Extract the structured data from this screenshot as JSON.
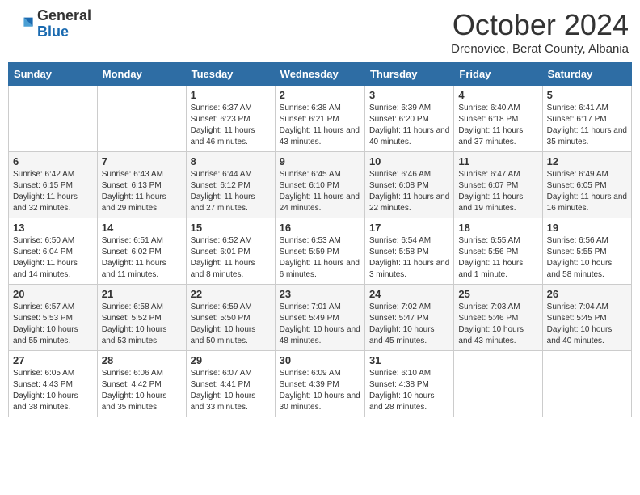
{
  "logo": {
    "general": "General",
    "blue": "Blue"
  },
  "title": "October 2024",
  "location": "Drenovice, Berat County, Albania",
  "days_of_week": [
    "Sunday",
    "Monday",
    "Tuesday",
    "Wednesday",
    "Thursday",
    "Friday",
    "Saturday"
  ],
  "weeks": [
    [
      {
        "day": "",
        "info": ""
      },
      {
        "day": "",
        "info": ""
      },
      {
        "day": "1",
        "info": "Sunrise: 6:37 AM\nSunset: 6:23 PM\nDaylight: 11 hours and 46 minutes."
      },
      {
        "day": "2",
        "info": "Sunrise: 6:38 AM\nSunset: 6:21 PM\nDaylight: 11 hours and 43 minutes."
      },
      {
        "day": "3",
        "info": "Sunrise: 6:39 AM\nSunset: 6:20 PM\nDaylight: 11 hours and 40 minutes."
      },
      {
        "day": "4",
        "info": "Sunrise: 6:40 AM\nSunset: 6:18 PM\nDaylight: 11 hours and 37 minutes."
      },
      {
        "day": "5",
        "info": "Sunrise: 6:41 AM\nSunset: 6:17 PM\nDaylight: 11 hours and 35 minutes."
      }
    ],
    [
      {
        "day": "6",
        "info": "Sunrise: 6:42 AM\nSunset: 6:15 PM\nDaylight: 11 hours and 32 minutes."
      },
      {
        "day": "7",
        "info": "Sunrise: 6:43 AM\nSunset: 6:13 PM\nDaylight: 11 hours and 29 minutes."
      },
      {
        "day": "8",
        "info": "Sunrise: 6:44 AM\nSunset: 6:12 PM\nDaylight: 11 hours and 27 minutes."
      },
      {
        "day": "9",
        "info": "Sunrise: 6:45 AM\nSunset: 6:10 PM\nDaylight: 11 hours and 24 minutes."
      },
      {
        "day": "10",
        "info": "Sunrise: 6:46 AM\nSunset: 6:08 PM\nDaylight: 11 hours and 22 minutes."
      },
      {
        "day": "11",
        "info": "Sunrise: 6:47 AM\nSunset: 6:07 PM\nDaylight: 11 hours and 19 minutes."
      },
      {
        "day": "12",
        "info": "Sunrise: 6:49 AM\nSunset: 6:05 PM\nDaylight: 11 hours and 16 minutes."
      }
    ],
    [
      {
        "day": "13",
        "info": "Sunrise: 6:50 AM\nSunset: 6:04 PM\nDaylight: 11 hours and 14 minutes."
      },
      {
        "day": "14",
        "info": "Sunrise: 6:51 AM\nSunset: 6:02 PM\nDaylight: 11 hours and 11 minutes."
      },
      {
        "day": "15",
        "info": "Sunrise: 6:52 AM\nSunset: 6:01 PM\nDaylight: 11 hours and 8 minutes."
      },
      {
        "day": "16",
        "info": "Sunrise: 6:53 AM\nSunset: 5:59 PM\nDaylight: 11 hours and 6 minutes."
      },
      {
        "day": "17",
        "info": "Sunrise: 6:54 AM\nSunset: 5:58 PM\nDaylight: 11 hours and 3 minutes."
      },
      {
        "day": "18",
        "info": "Sunrise: 6:55 AM\nSunset: 5:56 PM\nDaylight: 11 hours and 1 minute."
      },
      {
        "day": "19",
        "info": "Sunrise: 6:56 AM\nSunset: 5:55 PM\nDaylight: 10 hours and 58 minutes."
      }
    ],
    [
      {
        "day": "20",
        "info": "Sunrise: 6:57 AM\nSunset: 5:53 PM\nDaylight: 10 hours and 55 minutes."
      },
      {
        "day": "21",
        "info": "Sunrise: 6:58 AM\nSunset: 5:52 PM\nDaylight: 10 hours and 53 minutes."
      },
      {
        "day": "22",
        "info": "Sunrise: 6:59 AM\nSunset: 5:50 PM\nDaylight: 10 hours and 50 minutes."
      },
      {
        "day": "23",
        "info": "Sunrise: 7:01 AM\nSunset: 5:49 PM\nDaylight: 10 hours and 48 minutes."
      },
      {
        "day": "24",
        "info": "Sunrise: 7:02 AM\nSunset: 5:47 PM\nDaylight: 10 hours and 45 minutes."
      },
      {
        "day": "25",
        "info": "Sunrise: 7:03 AM\nSunset: 5:46 PM\nDaylight: 10 hours and 43 minutes."
      },
      {
        "day": "26",
        "info": "Sunrise: 7:04 AM\nSunset: 5:45 PM\nDaylight: 10 hours and 40 minutes."
      }
    ],
    [
      {
        "day": "27",
        "info": "Sunrise: 6:05 AM\nSunset: 4:43 PM\nDaylight: 10 hours and 38 minutes."
      },
      {
        "day": "28",
        "info": "Sunrise: 6:06 AM\nSunset: 4:42 PM\nDaylight: 10 hours and 35 minutes."
      },
      {
        "day": "29",
        "info": "Sunrise: 6:07 AM\nSunset: 4:41 PM\nDaylight: 10 hours and 33 minutes."
      },
      {
        "day": "30",
        "info": "Sunrise: 6:09 AM\nSunset: 4:39 PM\nDaylight: 10 hours and 30 minutes."
      },
      {
        "day": "31",
        "info": "Sunrise: 6:10 AM\nSunset: 4:38 PM\nDaylight: 10 hours and 28 minutes."
      },
      {
        "day": "",
        "info": ""
      },
      {
        "day": "",
        "info": ""
      }
    ]
  ]
}
